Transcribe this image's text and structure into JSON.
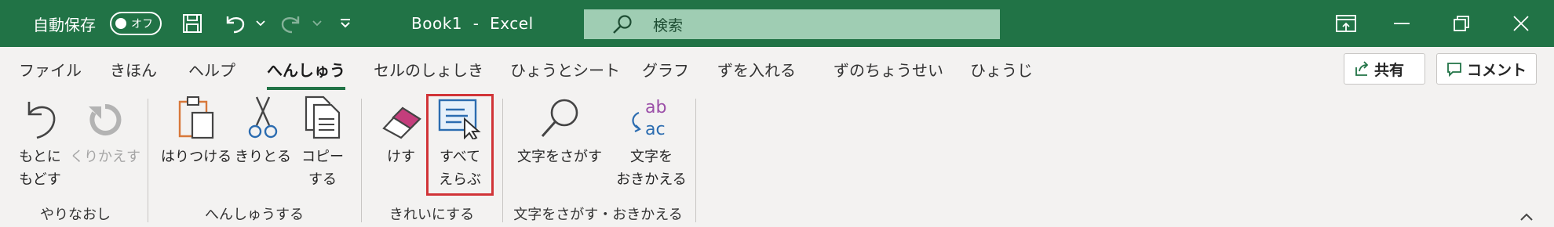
{
  "titlebar": {
    "autosave_label": "自動保存",
    "autosave_state": "オフ",
    "doc_title": "Book1  -  Excel",
    "search_placeholder": "検索",
    "bg_color": "#217346"
  },
  "tabs": [
    {
      "label": "ファイル"
    },
    {
      "label": "きほん"
    },
    {
      "label": "ヘルプ"
    },
    {
      "label": "へんしゅう",
      "active": true
    },
    {
      "label": "セルのしょしき"
    },
    {
      "label": "ひょうとシート"
    },
    {
      "label": "グラフ"
    },
    {
      "label": "ずを入れる"
    },
    {
      "label": "ずのちょうせい"
    },
    {
      "label": "ひょうじ"
    }
  ],
  "share_label": "共有",
  "comment_label": "コメント",
  "ribbon": {
    "undo": {
      "line1": "もとに",
      "line2": "もどす"
    },
    "redo": {
      "line1": "くりかえす"
    },
    "paste": {
      "line1": "はりつける"
    },
    "cut": {
      "line1": "きりとる"
    },
    "copy": {
      "line1": "コピー",
      "line2": "する"
    },
    "erase": {
      "line1": "けす"
    },
    "select_all": {
      "line1": "すべて",
      "line2": "えらぶ"
    },
    "find": {
      "line1": "文字をさがす"
    },
    "replace": {
      "line1": "文字を",
      "line2": "おきかえる"
    },
    "groups": {
      "undo_group": "やりなおし",
      "edit_group": "へんしゅうする",
      "clean_group": "きれいにする",
      "find_group": "文字をさがす・おきかえる"
    }
  },
  "colors": {
    "accent": "#217346",
    "highlight": "#d13438",
    "icon_blue": "#2b6cb0",
    "icon_orange": "#d8783a",
    "icon_pink": "#c43e7c"
  }
}
